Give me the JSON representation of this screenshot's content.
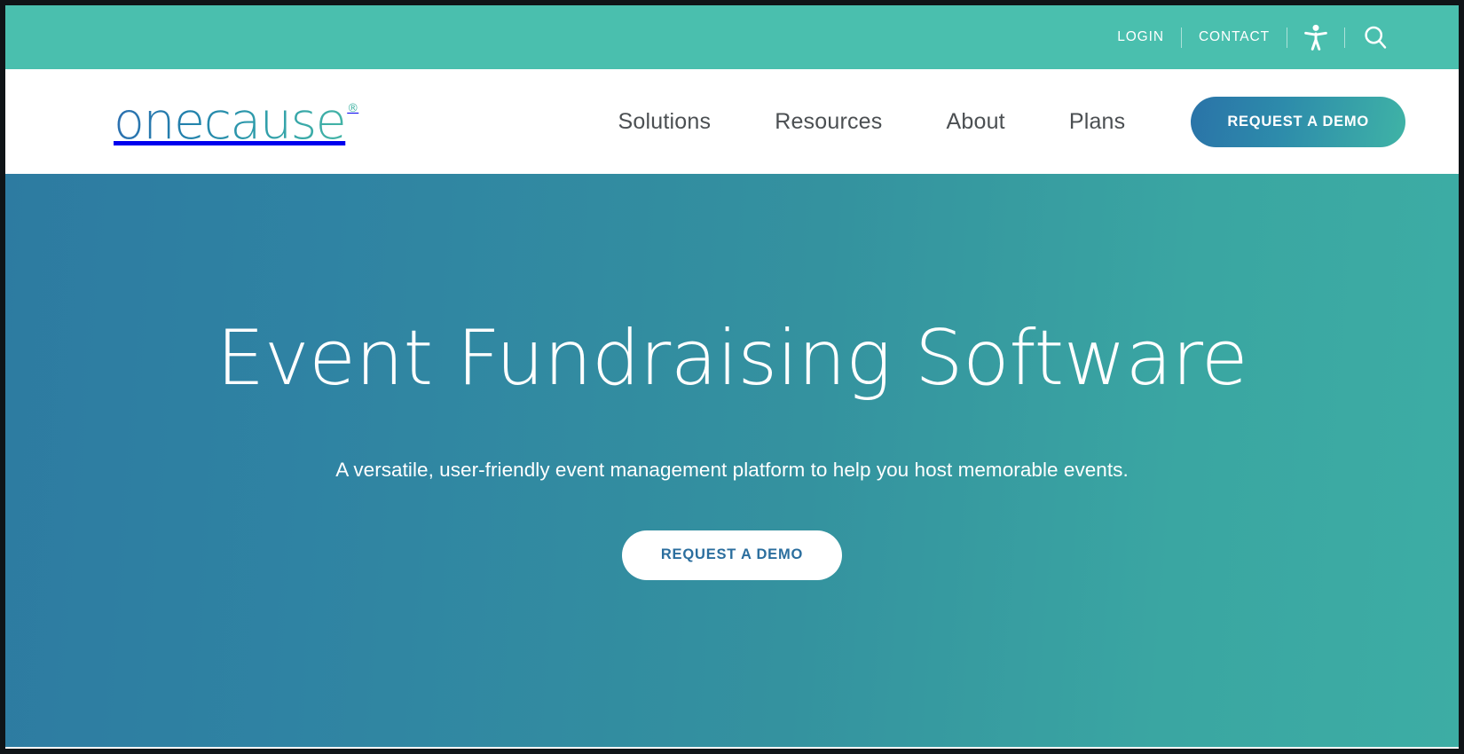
{
  "utility_bar": {
    "background_color": "#4abfae",
    "links": [
      {
        "label": "LOGIN"
      },
      {
        "label": "CONTACT"
      }
    ],
    "accessibility_icon": "accessibility-person-icon",
    "search_icon": "search-magnifier-icon"
  },
  "header": {
    "background_color": "#ffffff",
    "logo": {
      "text": "onecause",
      "registered_mark": "®",
      "gradient_start": "#2d6fb0",
      "gradient_end": "#45b5a6"
    },
    "nav": [
      {
        "label": "Solutions"
      },
      {
        "label": "Resources"
      },
      {
        "label": "About"
      },
      {
        "label": "Plans"
      }
    ],
    "cta": {
      "label": "REQUEST A DEMO",
      "gradient_start": "#2a73a8",
      "gradient_end": "#3fb3a6",
      "text_color": "#ffffff"
    }
  },
  "hero": {
    "title": "Event Fundraising Software",
    "subtitle": "A versatile, user-friendly event management platform to help you host memorable events.",
    "cta": {
      "label": "REQUEST A DEMO",
      "background_color": "#ffffff",
      "text_color": "#2b6e9e"
    },
    "gradient_start": "#2d7ba1",
    "gradient_end": "#3dada4"
  }
}
